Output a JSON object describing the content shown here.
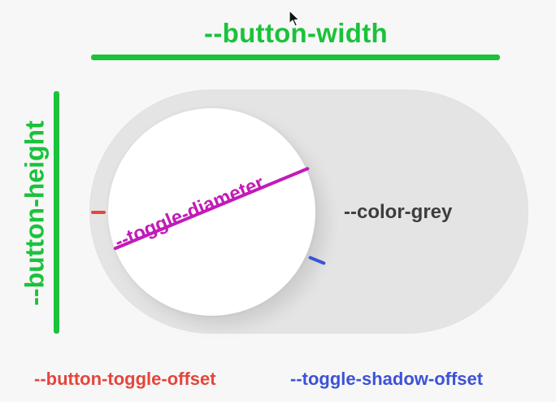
{
  "labels": {
    "button_width": "--button-width",
    "button_height": "--button-height",
    "toggle_diameter": "--toggle-diameter",
    "color_grey": "--color-grey",
    "button_toggle_offset": "--button-toggle-offset",
    "toggle_shadow_offset": "--toggle-shadow-offset"
  },
  "colors": {
    "dimension_green": "#1bc23b",
    "diameter_magenta": "#c21bb8",
    "track_grey": "#e4e4e4",
    "toggle_white": "#ffffff",
    "offset_red": "#e5453c",
    "shadow_blue": "#3d52d8"
  },
  "icons": {
    "cursor": "mouse-pointer-icon"
  }
}
